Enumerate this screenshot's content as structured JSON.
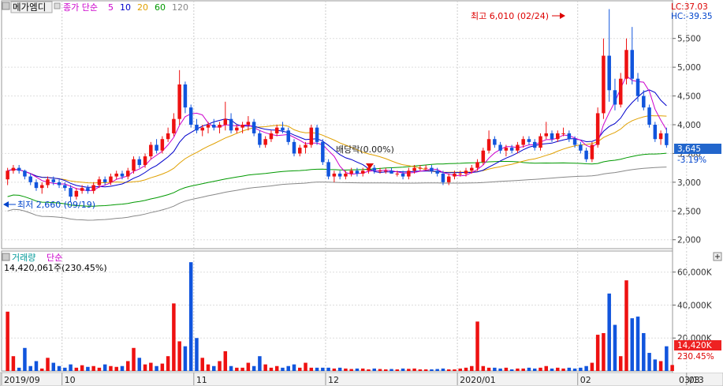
{
  "header": {
    "stock_name": "메가엠디",
    "ma_label": "종가 단순",
    "ma_periods": [
      {
        "label": "5",
        "color": "#cc00cc"
      },
      {
        "label": "10",
        "color": "#0000cc"
      },
      {
        "label": "20",
        "color": "#e0a000"
      },
      {
        "label": "60",
        "color": "#009900"
      },
      {
        "label": "120",
        "color": "#888888"
      }
    ],
    "lc": "LC:37.03",
    "hc": "HC:-39.35"
  },
  "annotations": {
    "high": "최고 6,010 (02/24)",
    "low": "최저 2,660 (09/19)",
    "dividend": "배당락(0.00%)"
  },
  "price_badge": {
    "price": "3,645",
    "change": "-3.19%"
  },
  "volume_header": {
    "title": "거래량",
    "ma_label": "단순",
    "value": "14,420,061주(230.45%)"
  },
  "volume_badge": {
    "value": "14,420K",
    "pct": "230.45%"
  },
  "x_labels": [
    "2019/09",
    "10",
    "11",
    "12",
    "2020/01",
    "02",
    "03",
    "03/13"
  ],
  "colors": {
    "up": "#ee1111",
    "down": "#1155dd",
    "ma5": "#cc00cc",
    "ma10": "#0000cc",
    "ma20": "#e0a000",
    "ma60": "#009900",
    "ma120": "#888888"
  },
  "chart_data": [
    {
      "type": "candlestick",
      "title": "메가엠디",
      "y_ticks": [
        "2,000",
        "2,500",
        "3,000",
        "3,500",
        "4,000",
        "4,500",
        "5,000",
        "5,500"
      ],
      "ylim": [
        1900,
        6100
      ],
      "grid": true,
      "candles": [
        [
          3050,
          3250,
          2950,
          3200
        ],
        [
          3200,
          3300,
          3150,
          3250
        ],
        [
          3250,
          3300,
          3150,
          3200
        ],
        [
          3200,
          3220,
          3050,
          3100
        ],
        [
          3100,
          3150,
          2950,
          3000
        ],
        [
          3000,
          3050,
          2850,
          2900
        ],
        [
          2900,
          3000,
          2800,
          2950
        ],
        [
          2950,
          3100,
          2900,
          3050
        ],
        [
          3050,
          3100,
          2950,
          3000
        ],
        [
          3000,
          3050,
          2900,
          2950
        ],
        [
          2950,
          3000,
          2850,
          2900
        ],
        [
          2900,
          2950,
          2660,
          2750
        ],
        [
          2750,
          2900,
          2700,
          2850
        ],
        [
          2850,
          2950,
          2800,
          2900
        ],
        [
          2900,
          2950,
          2800,
          2850
        ],
        [
          2850,
          3000,
          2800,
          2950
        ],
        [
          2950,
          3100,
          2900,
          3050
        ],
        [
          3050,
          3100,
          2950,
          3000
        ],
        [
          3000,
          3150,
          2950,
          3100
        ],
        [
          3100,
          3200,
          3050,
          3150
        ],
        [
          3150,
          3200,
          3050,
          3100
        ],
        [
          3100,
          3250,
          3050,
          3200
        ],
        [
          3200,
          3450,
          3150,
          3400
        ],
        [
          3400,
          3450,
          3250,
          3300
        ],
        [
          3300,
          3500,
          3250,
          3450
        ],
        [
          3450,
          3700,
          3400,
          3650
        ],
        [
          3650,
          3750,
          3500,
          3550
        ],
        [
          3550,
          3800,
          3500,
          3750
        ],
        [
          3750,
          3950,
          3700,
          3850
        ],
        [
          3850,
          4200,
          3800,
          4100
        ],
        [
          4100,
          4950,
          4000,
          4700
        ],
        [
          4700,
          4750,
          4200,
          4300
        ],
        [
          4300,
          4350,
          3950,
          4000
        ],
        [
          4000,
          4100,
          3850,
          3900
        ],
        [
          3900,
          4000,
          3800,
          3950
        ],
        [
          3950,
          4050,
          3850,
          4000
        ],
        [
          4000,
          4100,
          3900,
          3950
        ],
        [
          3950,
          4050,
          3850,
          4000
        ],
        [
          4000,
          4400,
          3900,
          4100
        ],
        [
          4100,
          4200,
          3850,
          3900
        ],
        [
          3900,
          4000,
          3850,
          3950
        ],
        [
          3950,
          4050,
          3850,
          4000
        ],
        [
          4000,
          4150,
          3900,
          4050
        ],
        [
          4050,
          4100,
          3800,
          3850
        ],
        [
          3850,
          3900,
          3600,
          3650
        ],
        [
          3650,
          3800,
          3600,
          3750
        ],
        [
          3750,
          3900,
          3700,
          3850
        ],
        [
          3850,
          4000,
          3800,
          3950
        ],
        [
          3950,
          4050,
          3850,
          3900
        ],
        [
          3900,
          3950,
          3650,
          3700
        ],
        [
          3700,
          3750,
          3450,
          3500
        ],
        [
          3500,
          3650,
          3450,
          3600
        ],
        [
          3600,
          3700,
          3500,
          3650
        ],
        [
          3650,
          4000,
          3600,
          3950
        ],
        [
          3950,
          4000,
          3650,
          3700
        ],
        [
          3700,
          3750,
          3300,
          3350
        ],
        [
          3350,
          3400,
          3050,
          3100
        ],
        [
          3100,
          3200,
          3000,
          3150
        ],
        [
          3150,
          3200,
          3050,
          3100
        ],
        [
          3100,
          3200,
          3050,
          3150
        ],
        [
          3150,
          3250,
          3100,
          3200
        ],
        [
          3200,
          3250,
          3100,
          3150
        ],
        [
          3150,
          3250,
          3100,
          3200
        ],
        [
          3200,
          3300,
          3150,
          3250
        ],
        [
          3250,
          3300,
          3150,
          3200
        ],
        [
          3200,
          3250,
          3150,
          3200
        ],
        [
          3200,
          3250,
          3150,
          3200
        ],
        [
          3200,
          3250,
          3150,
          3150
        ],
        [
          3150,
          3200,
          3100,
          3150
        ],
        [
          3150,
          3200,
          3050,
          3100
        ],
        [
          3100,
          3250,
          3050,
          3200
        ],
        [
          3200,
          3300,
          3150,
          3250
        ],
        [
          3250,
          3300,
          3200,
          3250
        ],
        [
          3250,
          3300,
          3200,
          3250
        ],
        [
          3250,
          3300,
          3150,
          3200
        ],
        [
          3200,
          3250,
          3100,
          3150
        ],
        [
          3150,
          3200,
          2950,
          3000
        ],
        [
          3000,
          3150,
          2950,
          3100
        ],
        [
          3100,
          3200,
          3050,
          3150
        ],
        [
          3150,
          3200,
          3100,
          3150
        ],
        [
          3150,
          3250,
          3100,
          3200
        ],
        [
          3200,
          3300,
          3150,
          3250
        ],
        [
          3250,
          3400,
          3200,
          3350
        ],
        [
          3350,
          3600,
          3300,
          3550
        ],
        [
          3550,
          3900,
          3500,
          3750
        ],
        [
          3750,
          3800,
          3600,
          3650
        ],
        [
          3650,
          3700,
          3500,
          3550
        ],
        [
          3550,
          3650,
          3450,
          3600
        ],
        [
          3600,
          3650,
          3500,
          3550
        ],
        [
          3550,
          3700,
          3500,
          3650
        ],
        [
          3650,
          3800,
          3600,
          3750
        ],
        [
          3750,
          3800,
          3650,
          3700
        ],
        [
          3700,
          3750,
          3550,
          3600
        ],
        [
          3600,
          3850,
          3550,
          3800
        ],
        [
          3800,
          4050,
          3750,
          3850
        ],
        [
          3850,
          3900,
          3700,
          3750
        ],
        [
          3750,
          3900,
          3700,
          3850
        ],
        [
          3850,
          3950,
          3800,
          3850
        ],
        [
          3850,
          3900,
          3700,
          3750
        ],
        [
          3750,
          3800,
          3600,
          3650
        ],
        [
          3650,
          3700,
          3500,
          3550
        ],
        [
          3550,
          3600,
          3350,
          3400
        ],
        [
          3400,
          3700,
          3350,
          3650
        ],
        [
          3650,
          4300,
          3600,
          4200
        ],
        [
          4200,
          5500,
          4100,
          5200
        ],
        [
          5200,
          6010,
          4400,
          4600
        ],
        [
          4600,
          4800,
          4250,
          4350
        ],
        [
          4350,
          4900,
          4300,
          4800
        ],
        [
          4800,
          5500,
          4700,
          5300
        ],
        [
          5300,
          5700,
          4700,
          4800
        ],
        [
          4800,
          4900,
          4400,
          4500
        ],
        [
          4500,
          4600,
          4250,
          4300
        ],
        [
          4300,
          4350,
          3950,
          4000
        ],
        [
          4000,
          4050,
          3700,
          3750
        ],
        [
          3750,
          3900,
          3650,
          3850
        ],
        [
          3850,
          3950,
          3600,
          3645
        ]
      ],
      "ma_lines": [
        "MA5",
        "MA10",
        "MA20",
        "MA60",
        "MA120"
      ]
    },
    {
      "type": "bar",
      "title": "거래량",
      "y_ticks": [
        "20,000K",
        "40,000K",
        "60,000K"
      ],
      "ylim": [
        0,
        68000
      ],
      "unit": "K",
      "values": [
        36000,
        9000,
        2000,
        14000,
        3000,
        6000,
        1500,
        8000,
        5000,
        3000,
        2000,
        4000,
        2000,
        3500,
        2500,
        3000,
        2000,
        4000,
        3000,
        2500,
        3000,
        6000,
        14000,
        8000,
        4000,
        5000,
        3000,
        4500,
        9000,
        41000,
        18000,
        15000,
        66000,
        20000,
        8000,
        4000,
        3000,
        6000,
        12000,
        3000,
        2000,
        2000,
        5000,
        3000,
        9000,
        4000,
        2000,
        3000,
        2000,
        3000,
        4000,
        2000,
        5000,
        2000,
        2000,
        2000,
        2000,
        1500,
        2000,
        1500,
        1200,
        1500,
        1500,
        1000,
        1500,
        1200,
        1000,
        1200,
        1000,
        1500,
        1300,
        1500,
        1000,
        1000,
        1000,
        1200,
        1500,
        1000,
        1000,
        1500,
        2000,
        3000,
        30000,
        3000,
        2000,
        2000,
        1500,
        2000,
        1000,
        1500,
        1500,
        2000,
        1500,
        2000,
        3000,
        1500,
        2000,
        1500,
        2000,
        1500,
        2000,
        3000,
        5000,
        22000,
        23000,
        47000,
        28000,
        9000,
        55000,
        32000,
        33000,
        23000,
        11000,
        7000,
        6000,
        15000,
        3645
      ],
      "value_list_note_unused": ""
    }
  ]
}
